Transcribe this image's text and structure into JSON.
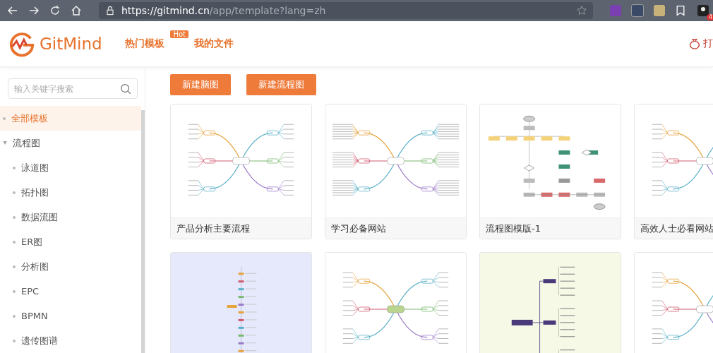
{
  "browser": {
    "url_host": "https://gitmind.cn",
    "url_path": "/app/template?lang=zh",
    "profile_badge": "4"
  },
  "header": {
    "logo": "GitMind",
    "nav": [
      {
        "label": "热门模板",
        "badge": "Hot"
      },
      {
        "label": "我的文件"
      }
    ],
    "right_text": "打"
  },
  "sidebar": {
    "search": {
      "placeholder": "输入关键字搜索"
    },
    "items": [
      {
        "label": "全部模板",
        "selected": true
      },
      {
        "label": "流程图",
        "selected": false,
        "expanded": true,
        "children": [
          {
            "label": "泳道图",
            "selected": false
          },
          {
            "label": "拓扑图",
            "selected": false
          },
          {
            "label": "数据流图",
            "selected": false
          },
          {
            "label": "ER图",
            "selected": false
          },
          {
            "label": "分析图",
            "selected": false
          },
          {
            "label": "EPC",
            "selected": false
          },
          {
            "label": "BPMN",
            "selected": false
          },
          {
            "label": "遗传图谱",
            "selected": false
          }
        ]
      }
    ]
  },
  "buttons": [
    "新建脑图",
    "新建流程图"
  ],
  "templates": [
    {
      "kind": "radial",
      "title": "产品分析主要流程"
    },
    {
      "kind": "radial-dense",
      "title": "学习必备网站"
    },
    {
      "kind": "flowchart",
      "title": "流程图模版-1"
    },
    {
      "kind": "radial",
      "title": "高效人士必看网站"
    },
    {
      "kind": "vertical"
    },
    {
      "kind": "radial-boxed"
    },
    {
      "kind": "logic"
    },
    {
      "kind": "radial"
    }
  ]
}
